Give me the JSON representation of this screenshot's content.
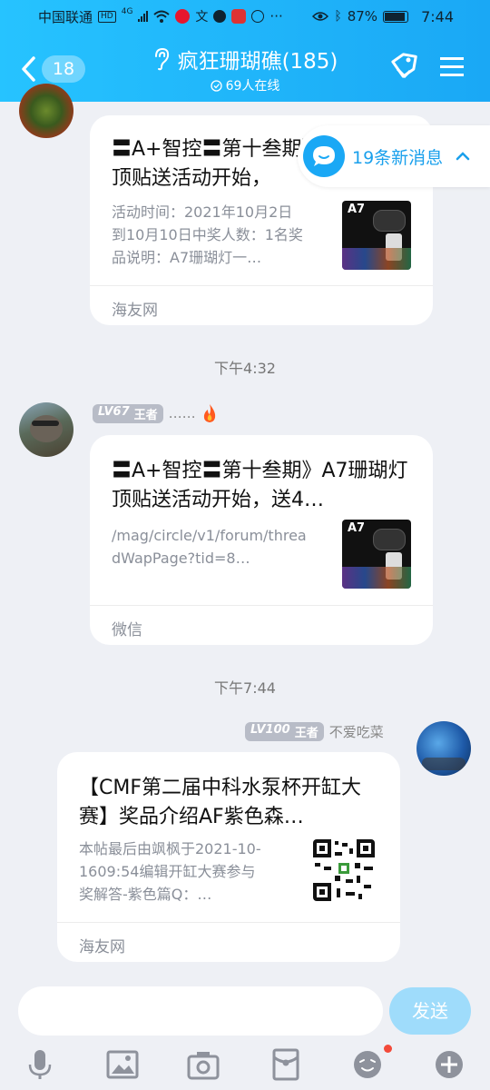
{
  "status_bar": {
    "carrier": "中国联通",
    "network": "4G",
    "battery": "87%",
    "time": "7:44"
  },
  "header": {
    "back_count": "18",
    "group_name": "疯狂珊瑚礁(185)",
    "online": "69人在线",
    "icons": [
      "ear-icon",
      "tag-icon",
      "menu-icon"
    ]
  },
  "new_messages": {
    "label": "19条新消息"
  },
  "messages": [
    {
      "card_title": "〓A+智控〓第十叁期》A7珊瑚灯顶贴送活动开始，",
      "card_desc": "活动时间：2021年10月2日到10月10日中奖人数：1名奖品说明：A7珊瑚灯一…",
      "card_source": "海友网",
      "thumb_label": "A7"
    },
    {
      "timestamp": "下午4:32",
      "level": "LV67",
      "rank": "王者",
      "sender": "……",
      "card_title": "〓A+智控〓第十叁期》A7珊瑚灯顶贴送活动开始，送4…",
      "card_desc": "/mag/circle/v1/forum/threadWapPage?tid=8…",
      "card_source": "微信",
      "thumb_label": "A7"
    },
    {
      "timestamp": "下午7:44",
      "level": "LV100",
      "rank": "王者",
      "sender": "不爱吃菜",
      "card_title": "【CMF第二届中科水泵杯开缸大赛】奖品介绍AF紫色森…",
      "card_desc": "本帖最后由飒枫于2021-10-1609:54编辑开缸大赛参与奖解答-紫色篇Q：…",
      "card_source": "海友网"
    }
  ],
  "composer": {
    "send_label": "发送",
    "placeholder": ""
  },
  "toolbar": [
    "microphone-icon",
    "image-icon",
    "camera-icon",
    "red-packet-icon",
    "emoji-icon",
    "plus-icon"
  ],
  "colors": {
    "accent": "#1aa8f5",
    "header": "#26c3ff",
    "background": "#eef0f5"
  }
}
